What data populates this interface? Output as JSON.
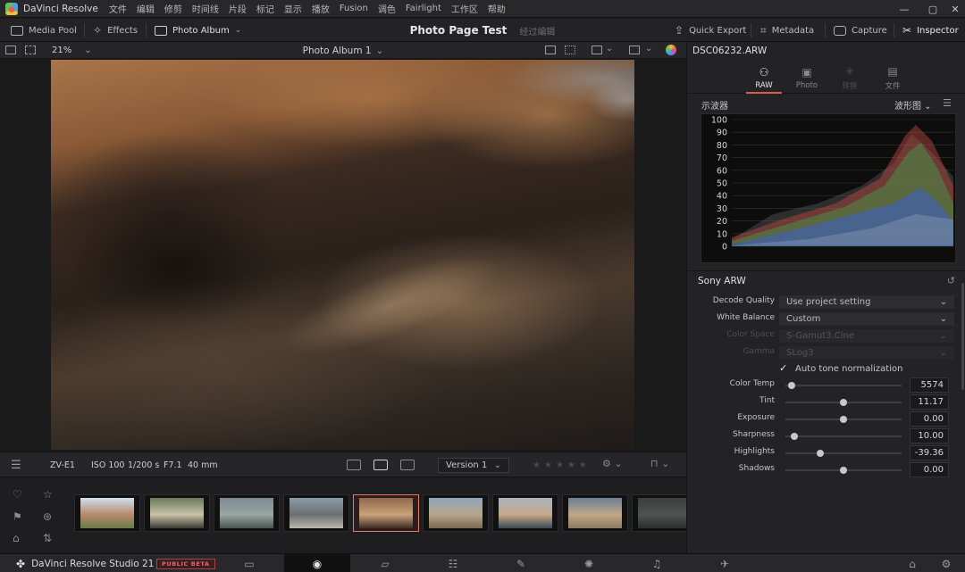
{
  "app": {
    "name": "DaVinci Resolve",
    "menu": [
      "文件",
      "编辑",
      "修剪",
      "时间线",
      "片段",
      "标记",
      "显示",
      "播放",
      "Fusion",
      "调色",
      "Fairlight",
      "工作区",
      "帮助"
    ],
    "window_controls": [
      "—",
      "▢",
      "✕"
    ]
  },
  "toolbar": {
    "media_pool": "Media Pool",
    "effects": "Effects",
    "photo_album": "Photo Album",
    "project_title": "Photo Page Test",
    "project_status": "经过编辑",
    "quick_export": "Quick Export",
    "metadata": "Metadata",
    "capture": "Capture",
    "inspector": "Inspector"
  },
  "viewer": {
    "zoom": "21%",
    "album_name": "Photo Album 1"
  },
  "infobar": {
    "camera": "ZV-E1",
    "iso": "ISO 100",
    "shutter": "1/200 s",
    "aperture": "F7.1",
    "focal": "40 mm",
    "version": "Version 1",
    "rating": 0
  },
  "filmstrip": {
    "selected_index": 4,
    "thumbs": [
      {
        "colors": [
          "#cfe0ee",
          "#b88a6a",
          "#6a7a4a"
        ]
      },
      {
        "colors": [
          "#6a7a5a",
          "#c9c2a8",
          "#3a3a32"
        ]
      },
      {
        "colors": [
          "#7b8a92",
          "#9aa6a0",
          "#4a5450"
        ]
      },
      {
        "colors": [
          "#8a9ba8",
          "#6a7070",
          "#b8b6ae"
        ]
      },
      {
        "colors": [
          "#8c6a4a",
          "#caa27a",
          "#3c2c22"
        ]
      },
      {
        "colors": [
          "#8fa6bd",
          "#b8a58a",
          "#7a6a52"
        ]
      },
      {
        "colors": [
          "#a9b4bf",
          "#c8a88a",
          "#3a4a52"
        ]
      },
      {
        "colors": [
          "#6a8098",
          "#c2a686",
          "#8a7a60"
        ]
      },
      {
        "colors": [
          "#3a3e3c",
          "#4e5450",
          "#2a2e2c"
        ]
      }
    ]
  },
  "pagebar": {
    "brand": "DaVinci Resolve Studio 21",
    "beta": "PUBLIC BETA"
  },
  "inspector": {
    "filename": "DSC06232.ARW",
    "tabs": [
      {
        "label": "RAW",
        "icon": "raw-icon",
        "state": "active"
      },
      {
        "label": "Photo",
        "icon": "photo-icon",
        "state": "normal"
      },
      {
        "label": "转换",
        "icon": "transform-icon",
        "state": "dim"
      },
      {
        "label": "文件",
        "icon": "file-icon",
        "state": "normal"
      }
    ],
    "scope_label": "示波器",
    "scope_mode": "波形图",
    "scope_ticks": [
      "100",
      "90",
      "80",
      "70",
      "60",
      "50",
      "40",
      "30",
      "20",
      "10",
      "0"
    ],
    "section": "Sony ARW",
    "decode_quality_label": "Decode Quality",
    "decode_quality_value": "Use project setting",
    "white_balance_label": "White Balance",
    "white_balance_value": "Custom",
    "color_space_label": "Color Space",
    "color_space_value": "S-Gamut3.Cine",
    "gamma_label": "Gamma",
    "gamma_value": "SLog3",
    "auto_tone_label": "Auto tone normalization",
    "sliders": [
      {
        "label": "Color Temp",
        "value": "5574",
        "pos": 0.05
      },
      {
        "label": "Tint",
        "value": "11.17",
        "pos": 0.5
      },
      {
        "label": "Exposure",
        "value": "0.00",
        "pos": 0.5
      },
      {
        "label": "Sharpness",
        "value": "10.00",
        "pos": 0.08
      },
      {
        "label": "Highlights",
        "value": "-39.36",
        "pos": 0.3
      },
      {
        "label": "Shadows",
        "value": "0.00",
        "pos": 0.5
      }
    ]
  }
}
